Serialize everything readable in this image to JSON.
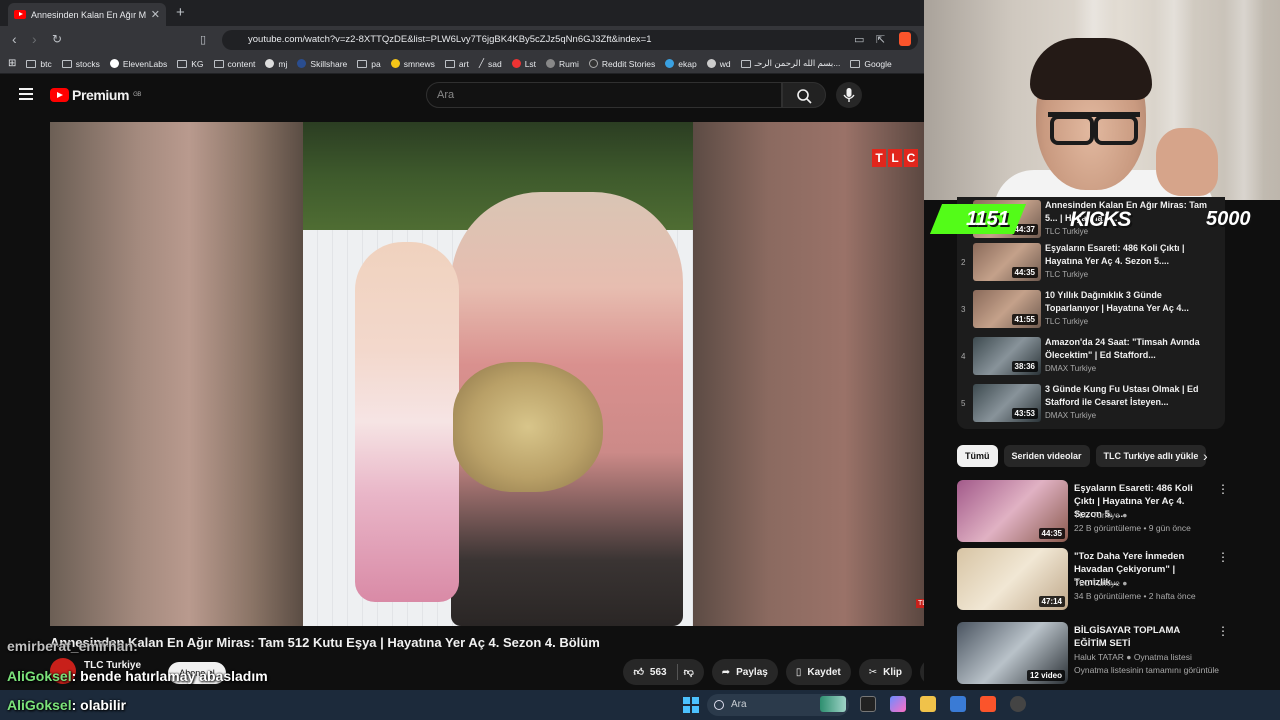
{
  "browser": {
    "tab_title": "Annesinden Kalan En Ağır Mi",
    "tab_close": "✕",
    "new_tab": "+",
    "url": "youtube.com/watch?v=z2-8XTTQzDE&list=PLW6Lvy7T6jgBK4KBy5cZJz5qNn6GJ3Zft&index=1",
    "bookmarks": [
      "btc",
      "stocks",
      "ElevenLabs",
      "KG",
      "content",
      "mj",
      "Skillshare",
      "pa",
      "smnews",
      "art",
      "sad",
      "Lst",
      "Rumi",
      "Reddit Stories",
      "ekap",
      "wd",
      "بسم الله الرحمن الرحـ...",
      "Google"
    ]
  },
  "youtube": {
    "logo_text": "Premium",
    "logo_region": "GB",
    "search_placeholder": "Ara"
  },
  "video": {
    "title": "Annesinden Kalan En Ağır Miras: Tam 512 Kutu Eşya | Hayatına Yer Aç 4. Sezon 4. Bölüm",
    "channel": "TLC Turkiye",
    "subscribe_label": "Abone ol",
    "likes": "563",
    "share_label": "Paylaş",
    "save_label": "Kaydet",
    "clip_label": "Klip",
    "tlc_letters": [
      "T",
      "L",
      "C"
    ],
    "tlc_small": "TLC"
  },
  "chat": [
    {
      "user": "emirberat_emirhan",
      "sep": ":",
      "message": ""
    },
    {
      "user": "AliGoksel",
      "sep": ":",
      "message": "bende hatırlamay abasladım"
    },
    {
      "user": "AliGoksel",
      "sep": ":",
      "message": "olabilir"
    }
  ],
  "stream_overlay": {
    "count": "1151",
    "label": "KICKS",
    "goal": "5000"
  },
  "playlist": [
    {
      "index": "",
      "title": "Annesinden Kalan En Ağır Miras: Tam 5... | Hayatına Y...",
      "channel": "TLC Turkiye",
      "duration": "44:37",
      "style": ""
    },
    {
      "index": "2",
      "title": "Eşyaların Esareti: 486 Koli Çıktı | Hayatına Yer Aç 4. Sezon 5....",
      "channel": "TLC Turkiye",
      "duration": "44:35",
      "style": ""
    },
    {
      "index": "3",
      "title": "10 Yıllık Dağınıklık 3 Günde Toparlanıyor | Hayatına Yer Aç 4...",
      "channel": "TLC Turkiye",
      "duration": "41:55",
      "style": ""
    },
    {
      "index": "4",
      "title": "Amazon'da 24 Saat: \"Timsah Avında Ölecektim\" | Ed Stafford...",
      "channel": "DMAX Turkiye",
      "duration": "38:36",
      "style": "dmax"
    },
    {
      "index": "5",
      "title": "3 Günde Kung Fu Ustası Olmak | Ed Stafford ile Cesaret İsteyen...",
      "channel": "DMAX Turkiye",
      "duration": "43:53",
      "style": "dmax"
    }
  ],
  "chips": [
    "Tümü",
    "Seriden videolar",
    "TLC Turkiye adlı yükle"
  ],
  "recommendations": [
    {
      "title": "Eşyaların Esareti: 486 Koli Çıktı | Hayatına Yer Aç 4. Sezon 5. ...",
      "channel": "TLC Turkiye",
      "meta": "22 B görüntüleme • 9 gün önce",
      "duration": "44:35",
      "style": ""
    },
    {
      "title": "\"Toz Daha Yere İnmeden Havadan Çekiyorum\" | Temizlik...",
      "channel": "TLC Turkiye",
      "meta": "34 B görüntüleme • 2 hafta önce",
      "duration": "47:14",
      "style": "t2"
    },
    {
      "title": "BİLGİSAYAR TOPLAMA EĞİTİM SETİ",
      "channel": "Haluk TATAR",
      "meta": "Oynatma listesi",
      "meta2": "Oynatma listesinin tamamını görüntüle",
      "duration": "12 video",
      "style": "t3"
    }
  ],
  "taskbar": {
    "search_placeholder": "Ara"
  }
}
